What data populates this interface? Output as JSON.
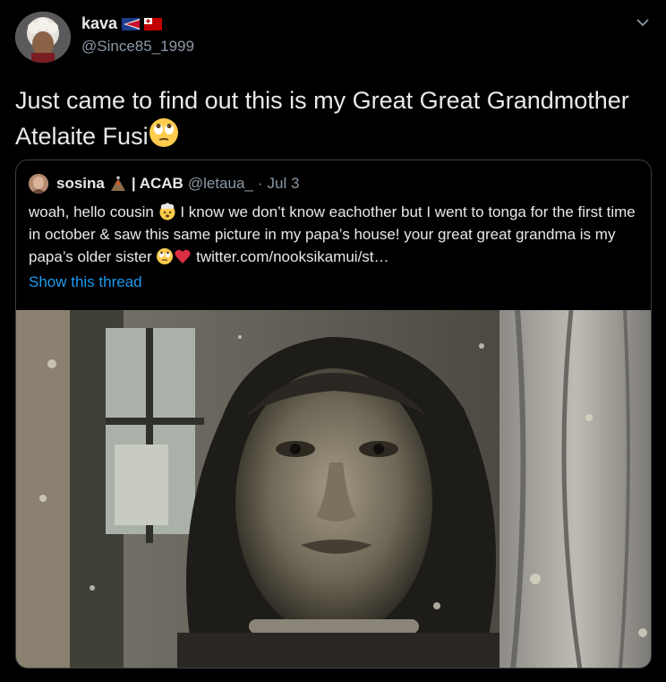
{
  "tweet": {
    "display_name": "kava",
    "flags": [
      "flag-american-samoa-icon",
      "flag-tonga-icon"
    ],
    "handle": "@Since85_1999",
    "text": "Just came to find out this is my Great Great Grandmother Atelaite Fusi",
    "text_emoji": "face-with-rolling-eyes-emoji"
  },
  "quote": {
    "display_name": "sosina",
    "name_emoji": "volcano-emoji",
    "name_suffix": "| ACAB",
    "handle": "@letaua_",
    "separator": "·",
    "date": "Jul 3",
    "body_part1": "woah, hello cousin",
    "body_part2": "I know we don’t know eachother but I went to tonga for the first time in october & saw this same picture in my papa’s house! your great great grandma is my papa’s older sister",
    "body_link": "twitter.com/nooksikamui/st…",
    "show_thread": "Show this thread"
  },
  "colors": {
    "background": "#000000",
    "text": "#e7e9ea",
    "muted": "#8b98a5",
    "link": "#1d9bf0",
    "border": "#3a3f44"
  }
}
